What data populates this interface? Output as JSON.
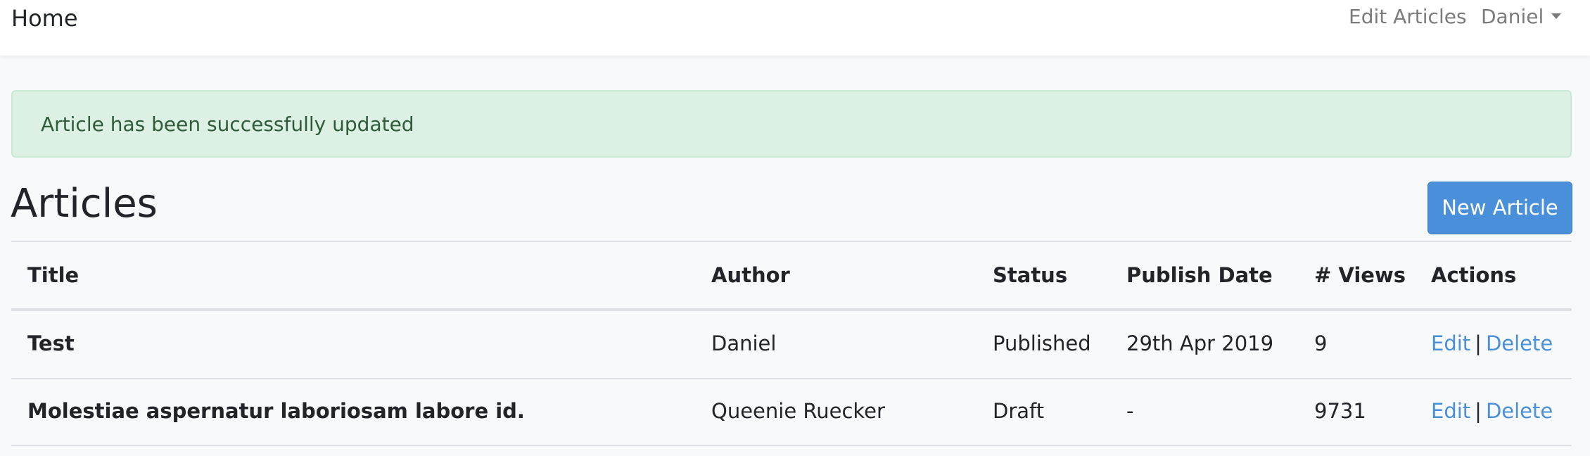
{
  "navbar": {
    "brand": "Home",
    "edit_articles": "Edit Articles",
    "user": "Daniel"
  },
  "alert": {
    "message": "Article has been successfully updated"
  },
  "page": {
    "title": "Articles",
    "new_button": "New Article"
  },
  "table": {
    "headers": {
      "title": "Title",
      "author": "Author",
      "status": "Status",
      "publish_date": "Publish Date",
      "views": "# Views",
      "actions": "Actions"
    },
    "rows": [
      {
        "title": "Test",
        "author": "Daniel",
        "status": "Published",
        "publish_date": "29th Apr 2019",
        "views": "9",
        "edit": "Edit",
        "separator": "|",
        "delete": "Delete"
      },
      {
        "title": "Molestiae aspernatur laboriosam labore id.",
        "author": "Queenie Ruecker",
        "status": "Draft",
        "publish_date": "-",
        "views": "9731",
        "edit": "Edit",
        "separator": "|",
        "delete": "Delete"
      }
    ]
  },
  "colors": {
    "primary": "#4a8fda",
    "alert_bg": "#dcf1e3",
    "alert_text": "#2f5b3b",
    "page_bg": "#f8f9fb"
  },
  "icons": {
    "user_menu": "caret-down-icon"
  }
}
